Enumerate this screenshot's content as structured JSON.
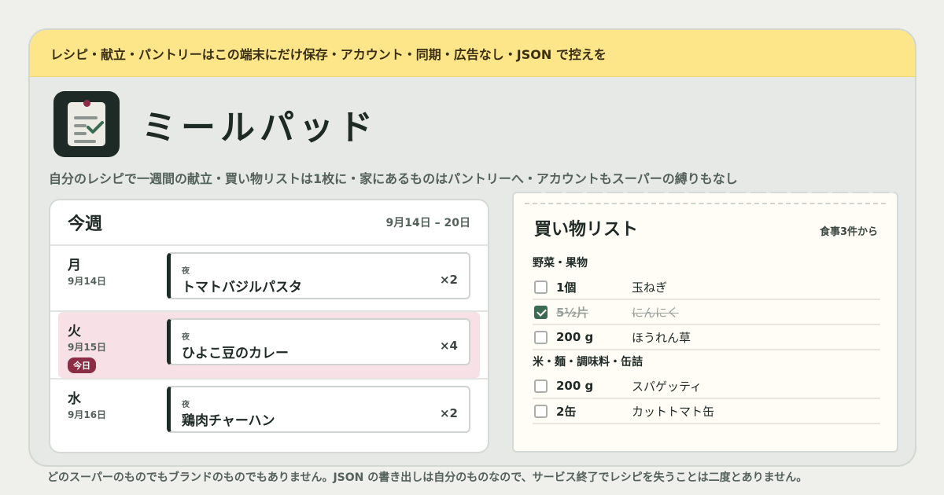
{
  "banner": {
    "text": "レシピ・献立・パントリーはこの端末にだけ保存・アカウント・同期・広告なし・JSON で控えを"
  },
  "app": {
    "title": "ミールパッド",
    "icon": "clipboard-check-icon"
  },
  "tagline": "自分のレシピで一週間の献立・買い物リストは1枚に・家にあるものはパントリーへ・アカウントもスーパーの縛りもなし",
  "week": {
    "title": "今週",
    "range": "9月14日 – 20日",
    "days": [
      {
        "name": "月",
        "date": "9月14日",
        "today": false,
        "badge": "",
        "meal": {
          "slot": "夜",
          "name": "トマトバジルパスタ",
          "multiplier": "×2"
        }
      },
      {
        "name": "火",
        "date": "9月15日",
        "today": true,
        "badge": "今日",
        "meal": {
          "slot": "夜",
          "name": "ひよこ豆のカレー",
          "multiplier": "×4"
        }
      },
      {
        "name": "水",
        "date": "9月16日",
        "today": false,
        "badge": "",
        "meal": {
          "slot": "夜",
          "name": "鶏肉チャーハン",
          "multiplier": "×2"
        }
      }
    ]
  },
  "shopping": {
    "title": "買い物リスト",
    "source": "食事3件から",
    "categories": [
      {
        "name": "野菜・果物",
        "items": [
          {
            "qty": "1個",
            "name": "玉ねぎ",
            "checked": false
          },
          {
            "qty": "5½片",
            "name": "にんにく",
            "checked": true
          },
          {
            "qty": "200 g",
            "name": "ほうれん草",
            "checked": false
          }
        ]
      },
      {
        "name": "米・麺・調味料・缶詰",
        "items": [
          {
            "qty": "200 g",
            "name": "スパゲッティ",
            "checked": false
          },
          {
            "qty": "2缶",
            "name": "カットトマト缶",
            "checked": false
          }
        ]
      }
    ]
  },
  "footer": "どのスーパーのものでもブランドのものでもありません。JSON の書き出しは自分のものなので、サービス終了でレシピを失うことは二度とありません。",
  "colors": {
    "banner": "#fde68a",
    "accent": "#8b2d45",
    "check": "#3b6c52",
    "ink": "#1e2a25"
  }
}
